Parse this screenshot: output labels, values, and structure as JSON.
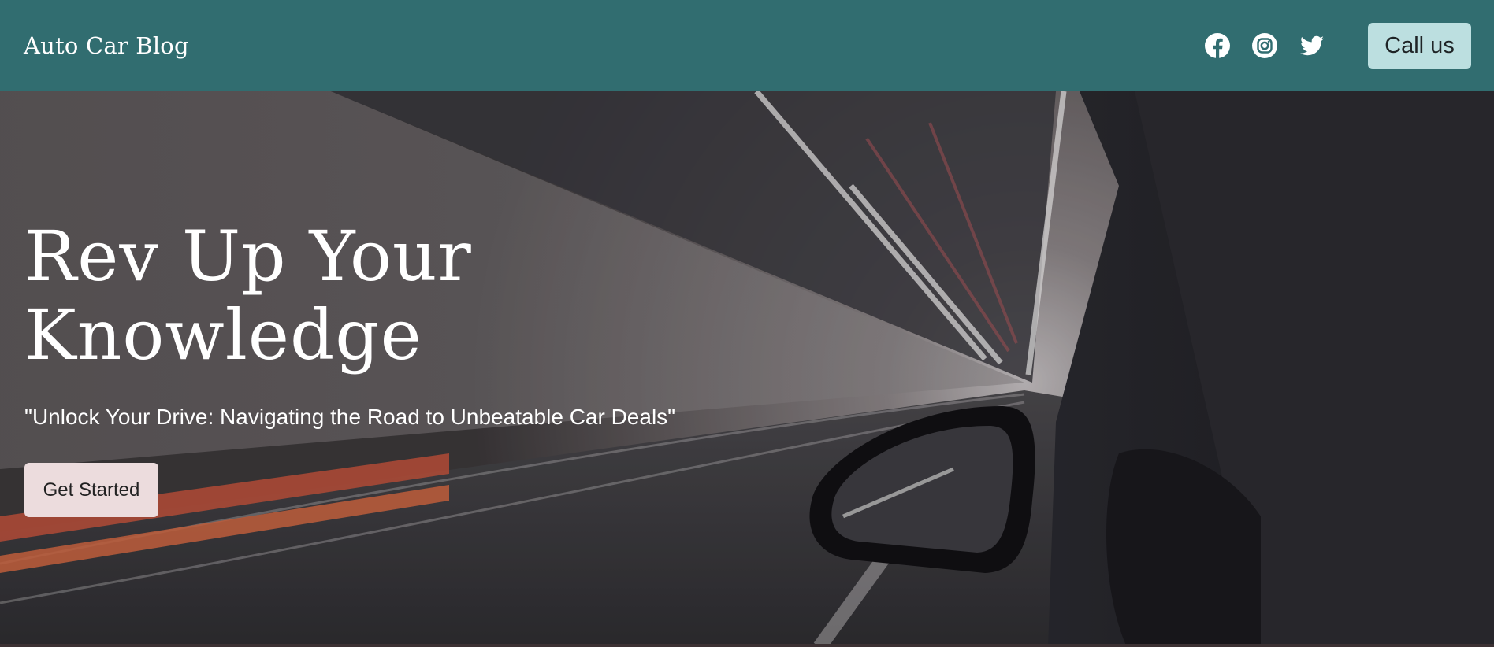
{
  "navbar": {
    "brand": "Auto Car Blog",
    "social_icons": [
      "facebook-icon",
      "instagram-icon",
      "twitter-icon"
    ],
    "call_button_label": "Call us",
    "colors": {
      "background": "#316d70",
      "call_button": "#bcdfe0"
    }
  },
  "hero": {
    "title_line1": "Rev Up Your",
    "title_line2": "Knowledge",
    "subtitle": "\"Unlock Your Drive: Navigating the Road to Unbeatable Car Deals\"",
    "cta_label": "Get Started",
    "background_image": "car-in-tunnel-motion-blur",
    "colors": {
      "cta_button": "#ecdcdd",
      "text": "#ffffff"
    }
  }
}
